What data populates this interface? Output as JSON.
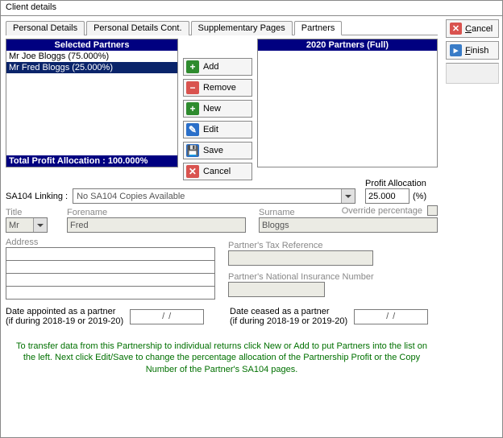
{
  "window": {
    "title": "Client details"
  },
  "tabs": {
    "t0": "Personal Details",
    "t1": "Personal Details Cont.",
    "t2": "Supplementary Pages",
    "t3": "Partners"
  },
  "side": {
    "cancel": "Cancel",
    "finish": "Finish"
  },
  "sel_panel": {
    "header": "Selected Partners",
    "rows": {
      "r0": "Mr Joe Bloggs (75.000%)",
      "r1": "Mr Fred Bloggs (25.000%)"
    },
    "footer": "Total Profit Allocation : 100.000%"
  },
  "right_panel": {
    "header": "2020 Partners (Full)"
  },
  "midbtns": {
    "add": "Add",
    "remove": "Remove",
    "new": "New",
    "edit": "Edit",
    "save": "Save",
    "cancel": "Cancel"
  },
  "linking": {
    "label": "SA104 Linking :",
    "value": "No SA104 Copies Available",
    "alloc_label": "Profit Allocation",
    "alloc_value": "25.000",
    "alloc_unit": "(%)"
  },
  "override": {
    "label": "Override percentage"
  },
  "fields": {
    "title_label": "Title",
    "title_value": "Mr",
    "fore_label": "Forename",
    "fore_value": "Fred",
    "surn_label": "Surname",
    "surn_value": "Bloggs",
    "addr_label": "Address",
    "tax_label": "Partner's Tax Reference",
    "ni_label": "Partner's National Insurance Number"
  },
  "dates": {
    "appointed_label_l1": "Date appointed as a partner",
    "appointed_label_l2": "(if during 2018-19 or 2019-20)",
    "appointed_value": "  /    /    ",
    "ceased_label_l1": "Date ceased as a partner",
    "ceased_label_l2": "(if during 2018-19 or 2019-20)",
    "ceased_value": "  /    /    "
  },
  "help": "To transfer data from this Partnership to individual returns click New or Add to put Partners into the list on the left. Next click Edit/Save to change the percentage allocation of the Partnership Profit or the Copy Number of the Partner's SA104 pages."
}
